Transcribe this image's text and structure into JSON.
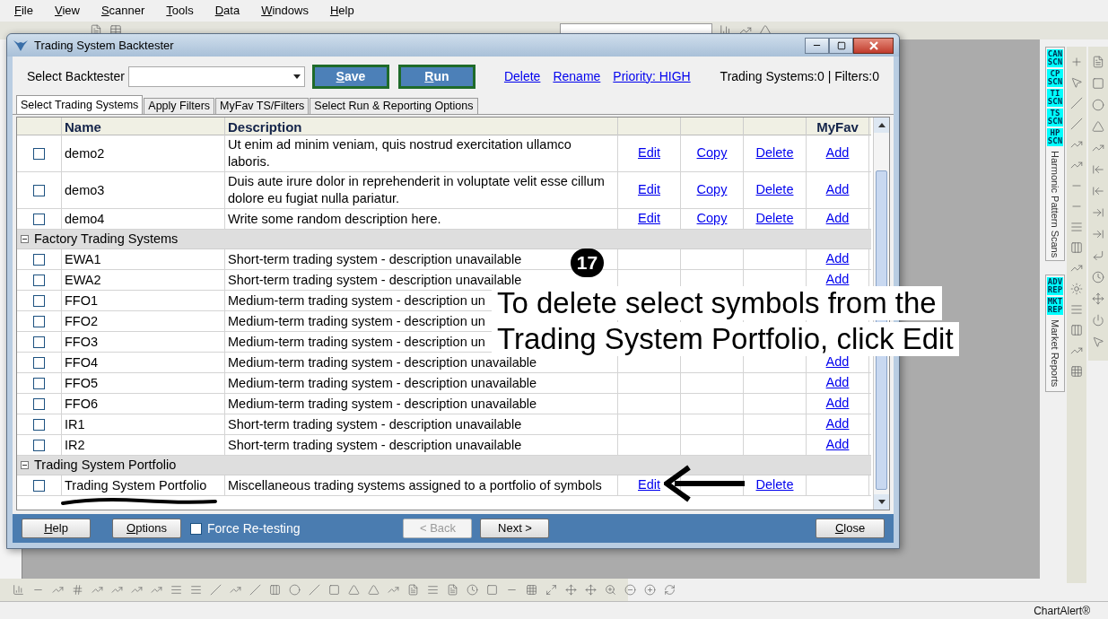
{
  "menu": [
    {
      "label": "File"
    },
    {
      "label": "View"
    },
    {
      "label": "Scanner"
    },
    {
      "label": "Tools"
    },
    {
      "label": "Data"
    },
    {
      "label": "Windows"
    },
    {
      "label": "Help"
    }
  ],
  "dialog": {
    "title": "Trading System Backtester",
    "select_label": "Select Backtester",
    "buttons": [
      {
        "label": "Save"
      },
      {
        "label": "Run"
      }
    ],
    "links": [
      "Delete",
      "Rename",
      "Priority: HIGH"
    ],
    "counter": "Trading Systems:0 | Filters:0",
    "tabs": [
      {
        "label": "Select Trading Systems",
        "selected": true
      },
      {
        "label": "Apply Filters",
        "selected": false
      },
      {
        "label": "MyFav TS/Filters",
        "selected": false
      },
      {
        "label": "Select Run & Reporting Options",
        "selected": false
      }
    ],
    "columns": {
      "name": "Name",
      "description": "Description",
      "myfav": "MyFav"
    },
    "groups": [
      {
        "rows": [
          {
            "checked": false,
            "name": "demo2",
            "description": "Ut enim ad minim veniam, quis nostrud exercitation ullamco laboris.",
            "edit": "Edit",
            "copy": "Copy",
            "delete": "Delete",
            "myfav": "Add"
          },
          {
            "checked": false,
            "name": "demo3",
            "description": "Duis aute irure dolor in reprehenderit in voluptate velit esse cillum dolore eu fugiat nulla pariatur.",
            "edit": "Edit",
            "copy": "Copy",
            "delete": "Delete",
            "myfav": "Add"
          },
          {
            "checked": false,
            "name": "demo4",
            "description": "Write some random description here.",
            "edit": "Edit",
            "copy": "Copy",
            "delete": "Delete",
            "myfav": "Add"
          }
        ]
      },
      {
        "title": "Factory Trading Systems",
        "expanded": true,
        "rows": [
          {
            "checked": false,
            "name": "EWA1",
            "description": "Short-term trading system - description unavailable",
            "myfav": "Add"
          },
          {
            "checked": false,
            "name": "EWA2",
            "description": "Short-term trading system - description unavailable",
            "myfav": "Add"
          },
          {
            "checked": false,
            "name": "FFO1",
            "description": "Medium-term trading system - description un"
          },
          {
            "checked": false,
            "name": "FFO2",
            "description": "Medium-term trading system - description un"
          },
          {
            "checked": false,
            "name": "FFO3",
            "description": "Medium-term trading system - description un"
          },
          {
            "checked": false,
            "name": "FFO4",
            "description": "Medium-term trading system - description unavailable",
            "myfav": "Add"
          },
          {
            "checked": false,
            "name": "FFO5",
            "description": "Medium-term trading system - description unavailable",
            "myfav": "Add"
          },
          {
            "checked": false,
            "name": "FFO6",
            "description": "Medium-term trading system - description unavailable",
            "myfav": "Add"
          },
          {
            "checked": false,
            "name": "IR1",
            "description": "Short-term trading system - description unavailable",
            "myfav": "Add"
          },
          {
            "checked": false,
            "name": "IR2",
            "description": "Short-term trading system - description unavailable",
            "myfav": "Add"
          }
        ]
      },
      {
        "title": "Trading System Portfolio",
        "expanded": true,
        "rows": [
          {
            "checked": false,
            "name": "Trading System Portfolio",
            "description": "Miscellaneous trading systems assigned to a portfolio of symbols",
            "edit": "Edit",
            "delete": "Delete"
          }
        ]
      }
    ],
    "footer": {
      "help": "Help",
      "options": "Options",
      "force_retesting": {
        "label": "Force Re-testing",
        "checked": false
      },
      "back": {
        "label": "< Back",
        "disabled": true
      },
      "next": {
        "label": "Next >",
        "disabled": false
      },
      "close": "Close"
    }
  },
  "annotation": {
    "step": "17",
    "lines": [
      "To delete select symbols from the",
      "Trading System Portfolio, click Edit"
    ]
  },
  "side_panel": {
    "scans": [
      {
        "lines": [
          "CAN",
          "SCN"
        ]
      },
      {
        "lines": [
          "CP",
          "SCN"
        ]
      },
      {
        "lines": [
          "TI",
          "SCN"
        ]
      },
      {
        "lines": [
          "TS",
          "SCN"
        ]
      },
      {
        "lines": [
          "HP",
          "SCN"
        ]
      }
    ],
    "scans_title": "Harmonic Pattern Scans",
    "reports": [
      {
        "lines": [
          "ADV",
          "REP"
        ]
      },
      {
        "lines": [
          "MKT",
          "REP"
        ]
      }
    ],
    "reports_title": "Market Reports"
  },
  "status_bar": {
    "app": "ChartAlert®"
  }
}
